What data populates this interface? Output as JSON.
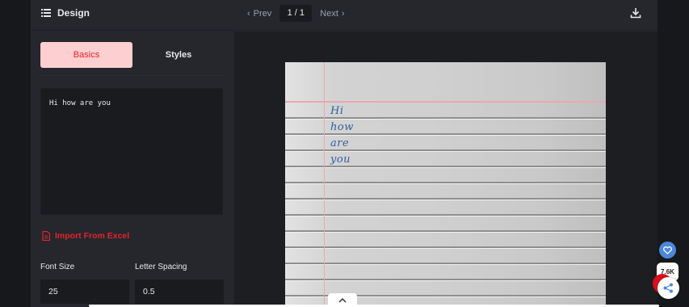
{
  "header": {
    "title": "Design",
    "prev_label": "Prev",
    "next_label": "Next",
    "page_indicator": "1 / 1",
    "download_icon": "download-icon"
  },
  "tabs": [
    {
      "label": "Basics",
      "active": true
    },
    {
      "label": "Styles",
      "active": false
    }
  ],
  "editor": {
    "text": "Hi how are you"
  },
  "import": {
    "label": "Import From Excel",
    "icon": "file-icon"
  },
  "fields": {
    "font_size": {
      "label": "Font Size",
      "value": "25"
    },
    "letter_spacing": {
      "label": "Letter Spacing",
      "value": "0.5"
    }
  },
  "preview": {
    "lines": [
      "Hi",
      "how",
      "are",
      "you"
    ]
  },
  "widgets": {
    "like_count": "7.6K"
  },
  "colors": {
    "accent": "#e3242b",
    "accent_bg": "#fdcfd0",
    "ink": "#2f5f9d",
    "panel": "#25272d",
    "dark": "#1a1b1f"
  }
}
